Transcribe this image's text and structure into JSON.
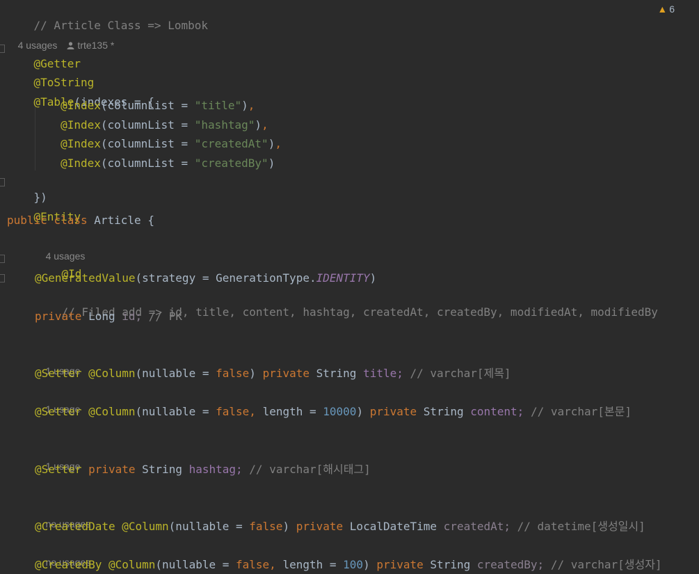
{
  "header": {
    "comment": "// Article Class => Lombok",
    "warning_count": "6",
    "usages": "4 usages",
    "author": "trte135 *"
  },
  "code": {
    "getter": "@Getter",
    "tostring": "@ToString",
    "table_ann": "@Table",
    "table_open": "(indexes = {",
    "index_ann": "@Index",
    "index_arg": "(columnList = ",
    "idx1_val": "\"title\"",
    "idx2_val": "\"hashtag\"",
    "idx3_val": "\"createdAt\"",
    "idx4_val": "\"createdBy\"",
    "close_paren": ")",
    "comma": ",",
    "table_close": "})",
    "entity": "@Entity",
    "kw_public": "public",
    "kw_class": "class",
    "class_name": "Article {",
    "id_usages": "4 usages",
    "id_ann": "@Id",
    "genval_ann": "@GeneratedValue",
    "genval_arg": "(strategy = GenerationType.",
    "identity": "IDENTITY",
    "fields_comment": "// Filed add => id, title, content, hashtag, createdAt, createdBy, modifiedAt, modifiedBy",
    "kw_private": "private",
    "type_long": "Long",
    "id_field": "id;",
    "id_comment": "// PK",
    "title_usages": "1 usage",
    "setter_ann": "@Setter",
    "column_ann": "@Column",
    "nullable_arg": "(nullable = ",
    "kw_false": "false",
    "length_arg": "length = ",
    "len_10000": "10000",
    "len_100": "100",
    "type_string": "String",
    "title_field": "title;",
    "title_comment": "// varchar[제목]",
    "content_usages": "1 usage",
    "content_field": "content;",
    "content_comment": "// varchar[본문]",
    "hashtag_usages": "1 usage",
    "hashtag_field": "hashtag;",
    "hashtag_comment": "// varchar[해시태그]",
    "createdat_usages": "no usages",
    "createddate_ann": "@CreatedDate",
    "type_ldt": "LocalDateTime",
    "createdat_field": "createdAt;",
    "createdat_comment": "// datetime[생성일시]",
    "createdby_usages": "no usages",
    "createdby_ann": "@CreatedBy",
    "createdby_field": "createdBy;",
    "createdby_comment": "// varchar[생성자]"
  },
  "colors": {
    "background": "#2b2b2b",
    "annotation": "#bbb529",
    "keyword": "#cc7832",
    "string": "#6a8759",
    "number": "#6897bb",
    "field": "#9876aa",
    "comment": "#808080"
  },
  "icons": {
    "warning": "warning-triangle-icon",
    "author": "person-icon",
    "fold": "fold-marker-icon"
  }
}
